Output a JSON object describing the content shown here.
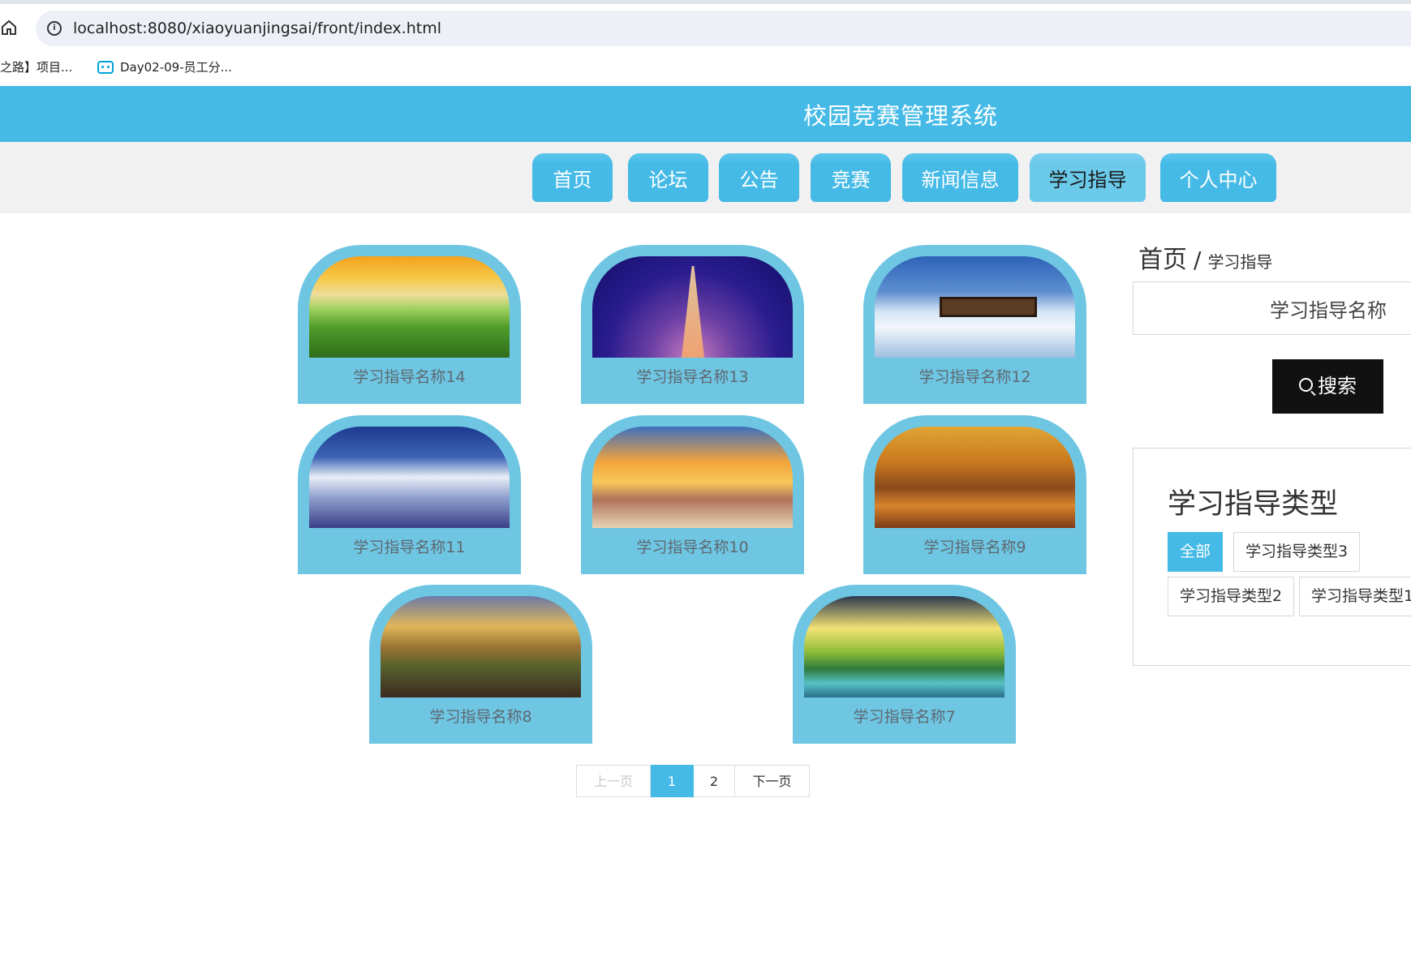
{
  "browser": {
    "url": "localhost:8080/xiaoyuanjingsai/front/index.html",
    "bookmarks": [
      "之路】项目...",
      "Day02-09-员工分..."
    ]
  },
  "header": {
    "title": "校园竞赛管理系统"
  },
  "nav": {
    "items": [
      "首页",
      "论坛",
      "公告",
      "竞赛",
      "新闻信息",
      "学习指导",
      "个人中心"
    ],
    "active": "学习指导"
  },
  "cards": [
    {
      "title": "学习指导名称14",
      "image": "meadow-sunset"
    },
    {
      "title": "学习指导名称13",
      "image": "eiffel-tower-night"
    },
    {
      "title": "学习指导名称12",
      "image": "snow-cabin"
    },
    {
      "title": "学习指导名称11",
      "image": "cloudy-sky"
    },
    {
      "title": "学习指导名称10",
      "image": "beach-sunset"
    },
    {
      "title": "学习指导名称9",
      "image": "autumn-trees"
    },
    {
      "title": "学习指导名称8",
      "image": "mountain-valley"
    },
    {
      "title": "学习指导名称7",
      "image": "lake-sunrise"
    }
  ],
  "pagination": {
    "prev": "上一页",
    "pages": [
      "1",
      "2"
    ],
    "current": "1",
    "next": "下一页"
  },
  "breadcrumb": {
    "home": "首页",
    "separator": "/",
    "current": "学习指导"
  },
  "search": {
    "value": "学习指导名称",
    "button": "搜索"
  },
  "types": {
    "title": "学习指导类型",
    "items": [
      "全部",
      "学习指导类型3",
      "学习指导类型2",
      "学习指导类型1"
    ],
    "active": "全部"
  },
  "colors": {
    "primary": "#45bae6",
    "card": "#6ec6e3",
    "nav_bg": "#f1f1f1",
    "search_button": "#111111"
  }
}
